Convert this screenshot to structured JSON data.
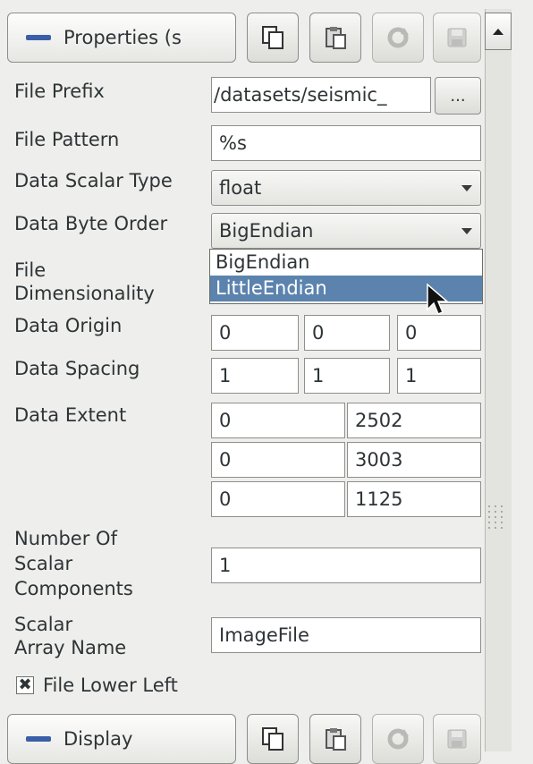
{
  "properties_section": {
    "title": "Properties (s",
    "tools": [
      "copy-icon",
      "paste-icon",
      "reset-icon",
      "save-icon"
    ]
  },
  "fields": {
    "file_prefix": {
      "label": "File Prefix",
      "value": "/datasets/seismic_",
      "browse_label": "..."
    },
    "file_pattern": {
      "label": "File Pattern",
      "value": "%s"
    },
    "data_scalar_type": {
      "label": "Data Scalar Type",
      "value": "float"
    },
    "data_byte_order": {
      "label": "Data Byte Order",
      "value": "BigEndian",
      "options": [
        "BigEndian",
        "LittleEndian"
      ],
      "highlighted": "LittleEndian"
    },
    "file_dimensionality": {
      "label_line1": "File",
      "label_line2": "Dimensionality"
    },
    "data_origin": {
      "label": "Data Origin",
      "values": [
        "0",
        "0",
        "0"
      ]
    },
    "data_spacing": {
      "label": "Data Spacing",
      "values": [
        "1",
        "1",
        "1"
      ]
    },
    "data_extent": {
      "label": "Data Extent",
      "rows": [
        [
          "0",
          "2502"
        ],
        [
          "0",
          "3003"
        ],
        [
          "0",
          "1125"
        ]
      ]
    },
    "number_of_scalar_components": {
      "label_line1": "Number Of",
      "label_line2": "Scalar",
      "label_line3": "Components",
      "value": "1"
    },
    "scalar_array_name": {
      "label_line1": "Scalar",
      "label_line2": "Array Name",
      "value": "ImageFile"
    },
    "file_lower_left": {
      "label": "File Lower Left",
      "checked": true,
      "mark": "✖"
    }
  },
  "display_section": {
    "title": "Display",
    "tools": [
      "copy-icon",
      "paste-icon",
      "reset-icon",
      "save-icon"
    ]
  },
  "colors": {
    "highlight": "#5b83ad",
    "section_icon": "#3b5ea8",
    "background": "#eeeeec"
  }
}
